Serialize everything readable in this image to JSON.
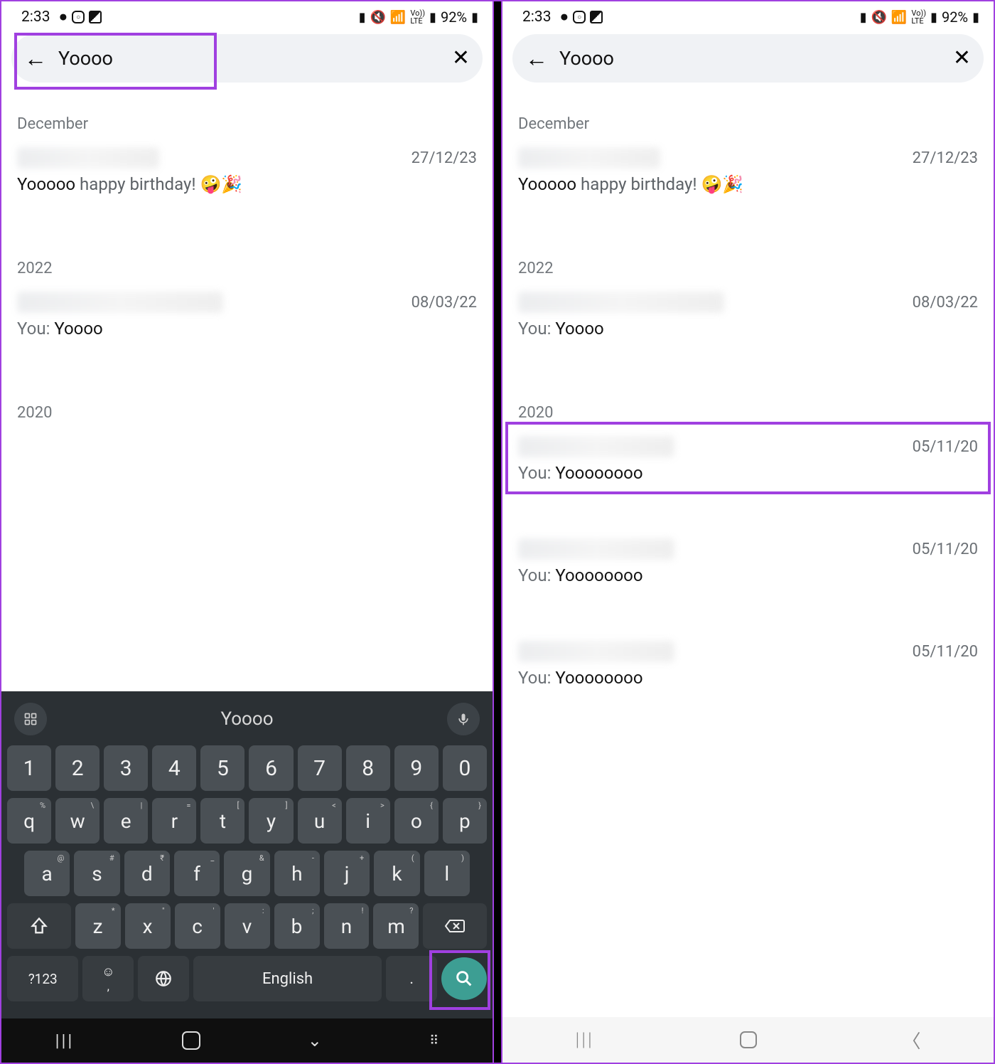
{
  "status": {
    "time": "2:33",
    "icons_left": [
      "chat-icon",
      "instagram-icon",
      "image-icon"
    ],
    "icons_right": [
      "battery-saver-icon",
      "mute-icon",
      "wifi-icon",
      "volte-icon",
      "signal-icon"
    ],
    "battery_pct": "92%"
  },
  "search": {
    "query": "Yoooo"
  },
  "left": {
    "sections": [
      {
        "label": "December",
        "items": [
          {
            "date": "27/12/23",
            "prefix": "",
            "match": "Yooooo",
            "rest": " happy birthday! 🤪🎉"
          }
        ]
      },
      {
        "label": "2022",
        "items": [
          {
            "date": "08/03/22",
            "prefix": "You: ",
            "match": "Yoooo",
            "rest": ""
          }
        ]
      },
      {
        "label": "2020",
        "items": []
      }
    ],
    "keyboard": {
      "suggestion": "Yoooo",
      "row_num": [
        "1",
        "2",
        "3",
        "4",
        "5",
        "6",
        "7",
        "8",
        "9",
        "0"
      ],
      "row_q": [
        {
          "k": "q",
          "s": "%"
        },
        {
          "k": "w",
          "s": "\\"
        },
        {
          "k": "e",
          "s": "|"
        },
        {
          "k": "r",
          "s": "="
        },
        {
          "k": "t",
          "s": "["
        },
        {
          "k": "y",
          "s": "]"
        },
        {
          "k": "u",
          "s": "<"
        },
        {
          "k": "i",
          "s": ">"
        },
        {
          "k": "o",
          "s": "{"
        },
        {
          "k": "p",
          "s": "}"
        }
      ],
      "row_a": [
        {
          "k": "a",
          "s": "@"
        },
        {
          "k": "s",
          "s": "#"
        },
        {
          "k": "d",
          "s": "₹"
        },
        {
          "k": "f",
          "s": "_"
        },
        {
          "k": "g",
          "s": "&"
        },
        {
          "k": "h",
          "s": "-"
        },
        {
          "k": "j",
          "s": "+"
        },
        {
          "k": "k",
          "s": "("
        },
        {
          "k": "l",
          "s": ")"
        }
      ],
      "row_z": [
        {
          "k": "z",
          "s": "*"
        },
        {
          "k": "x",
          "s": "\""
        },
        {
          "k": "c",
          "s": "'"
        },
        {
          "k": "v",
          "s": ":"
        },
        {
          "k": "b",
          "s": ";"
        },
        {
          "k": "n",
          "s": "!"
        },
        {
          "k": "m",
          "s": "?"
        }
      ],
      "sym_key": "?123",
      "space_label": "English"
    }
  },
  "right": {
    "sections": [
      {
        "label": "December",
        "items": [
          {
            "date": "27/12/23",
            "prefix": "",
            "match": "Yooooo",
            "rest": " happy birthday! 🤪🎉"
          }
        ]
      },
      {
        "label": "2022",
        "items": [
          {
            "date": "08/03/22",
            "prefix": "You: ",
            "match": "Yoooo",
            "rest": ""
          }
        ]
      },
      {
        "label": "2020",
        "items": [
          {
            "date": "05/11/20",
            "prefix": "You: ",
            "match": "Yoooo",
            "rest": "oooo"
          },
          {
            "date": "05/11/20",
            "prefix": "You: ",
            "match": "Yoooo",
            "rest": "oooo"
          },
          {
            "date": "05/11/20",
            "prefix": "You: ",
            "match": "Yoooo",
            "rest": "oooo"
          }
        ]
      }
    ]
  }
}
